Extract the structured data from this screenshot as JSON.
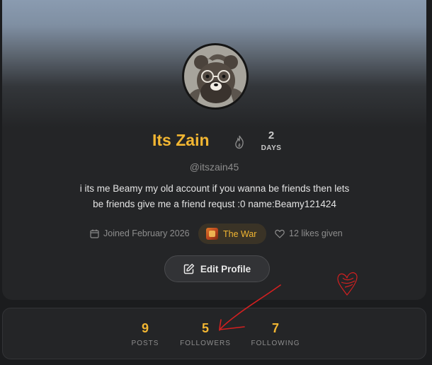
{
  "profile": {
    "name": "Its Zain",
    "handle": "@itszain45",
    "bio_line1": "i its me Beamy my old account if you wanna be friends then lets",
    "bio_line2": "be friends give me a friend requst :0 name:Beamy121424",
    "streak": {
      "count": "2",
      "unit": "DAYS",
      "icon": "flame-icon"
    },
    "joined": "Joined February 2026",
    "team": "The War",
    "likes_given": "12 likes given",
    "edit_label": "Edit Profile"
  },
  "stats": [
    {
      "value": "9",
      "label": "POSTS"
    },
    {
      "value": "5",
      "label": "FOLLOWERS"
    },
    {
      "value": "7",
      "label": "FOLLOWING"
    }
  ],
  "colors": {
    "accent": "#f2b632",
    "card": "#242527",
    "background": "#1b1c1e",
    "annotation": "#d42020"
  }
}
